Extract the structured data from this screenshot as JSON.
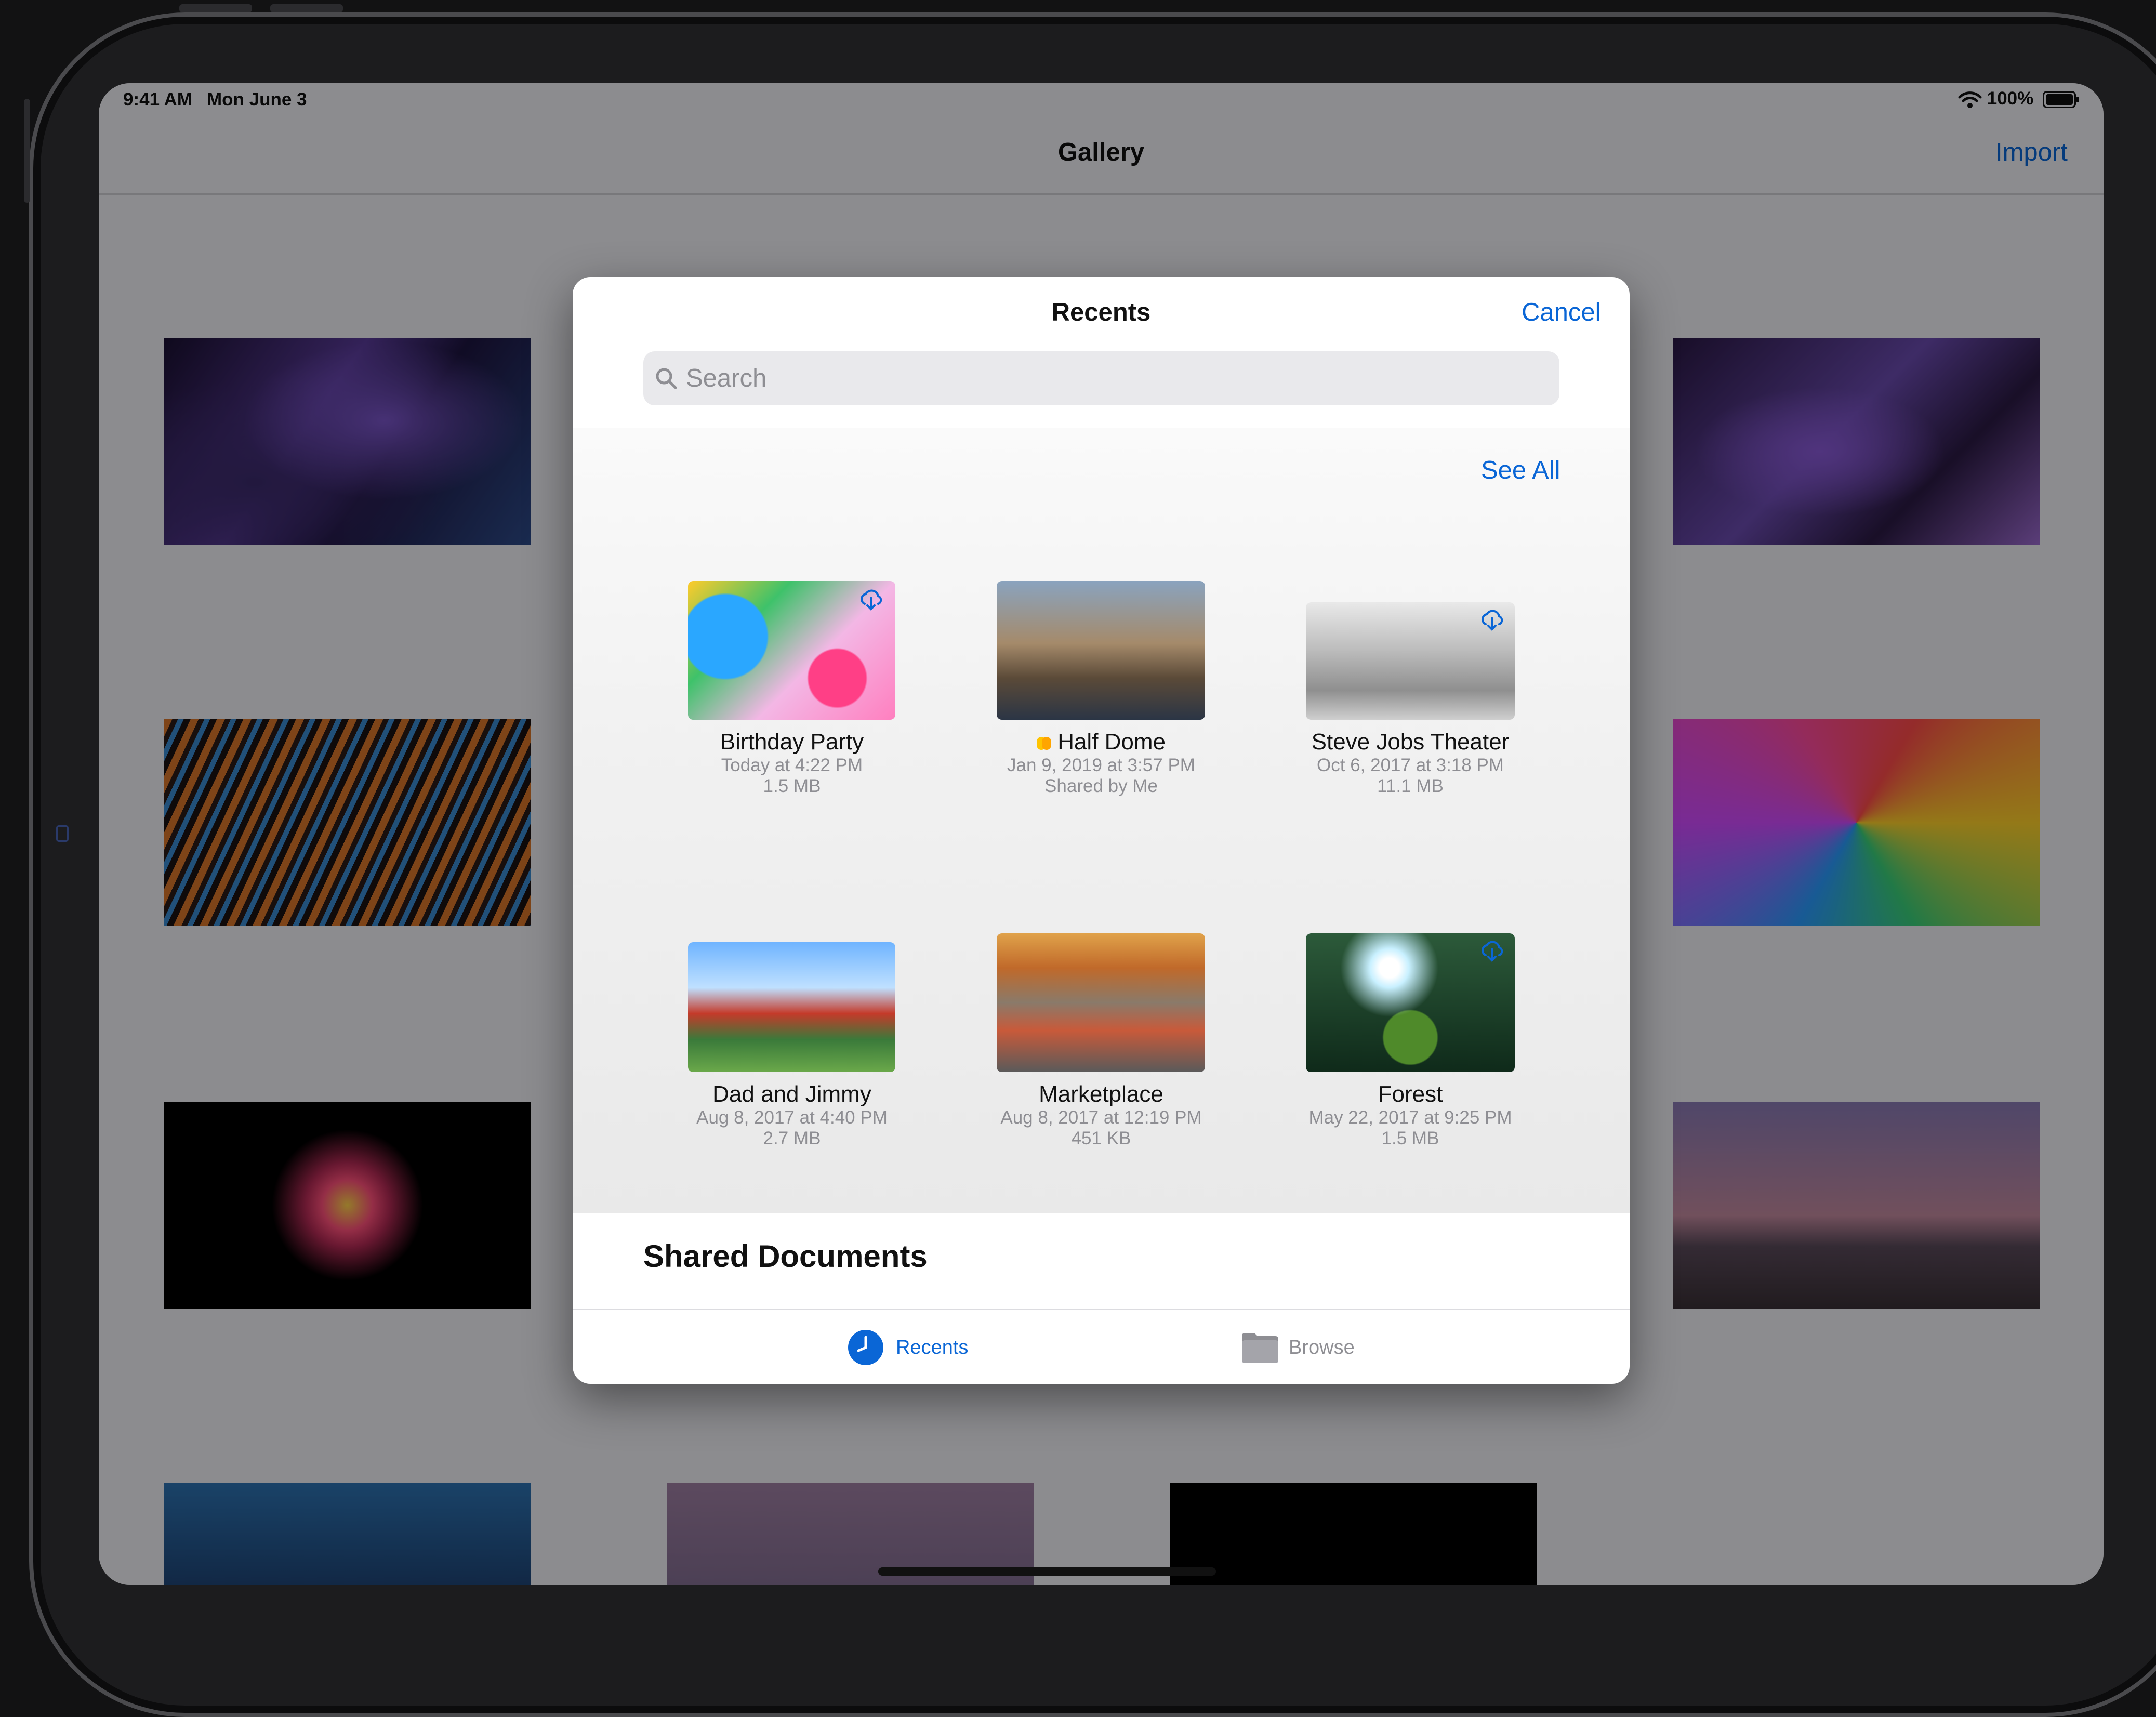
{
  "status_bar": {
    "time": "9:41 AM",
    "date": "Mon June 3",
    "battery": "100%"
  },
  "app": {
    "title": "Gallery",
    "import_label": "Import"
  },
  "picker": {
    "title": "Recents",
    "cancel_label": "Cancel",
    "search_placeholder": "Search",
    "see_all_label": "See All",
    "items": [
      {
        "name": "Birthday Party",
        "date": "Today at 4:22 PM",
        "detail": "1.5 MB",
        "icloud": true
      },
      {
        "name": "Half Dome",
        "date": "Jan 9, 2019 at 3:57 PM",
        "detail": "Shared by Me",
        "tag_colors": [
          "#ffc400",
          "#ffa500"
        ]
      },
      {
        "name": "Steve Jobs Theater",
        "date": "Oct 6, 2017 at 3:18 PM",
        "detail": "11.1 MB",
        "icloud": true
      },
      {
        "name": "Dad and Jimmy",
        "date": "Aug 8, 2017 at 4:40 PM",
        "detail": "2.7 MB"
      },
      {
        "name": "Marketplace",
        "date": "Aug 8, 2017 at 12:19 PM",
        "detail": "451 KB"
      },
      {
        "name": "Forest",
        "date": "May 22, 2017 at 9:25 PM",
        "detail": "1.5 MB",
        "icloud": true
      }
    ],
    "section_title": "Shared Documents",
    "tabs": [
      {
        "label": "Recents",
        "icon": "clock-icon",
        "selected": true
      },
      {
        "label": "Browse",
        "icon": "folder-icon",
        "selected": false
      }
    ]
  },
  "colors": {
    "accent": "#0a66d6",
    "secondary_text": "#8e8e93"
  }
}
